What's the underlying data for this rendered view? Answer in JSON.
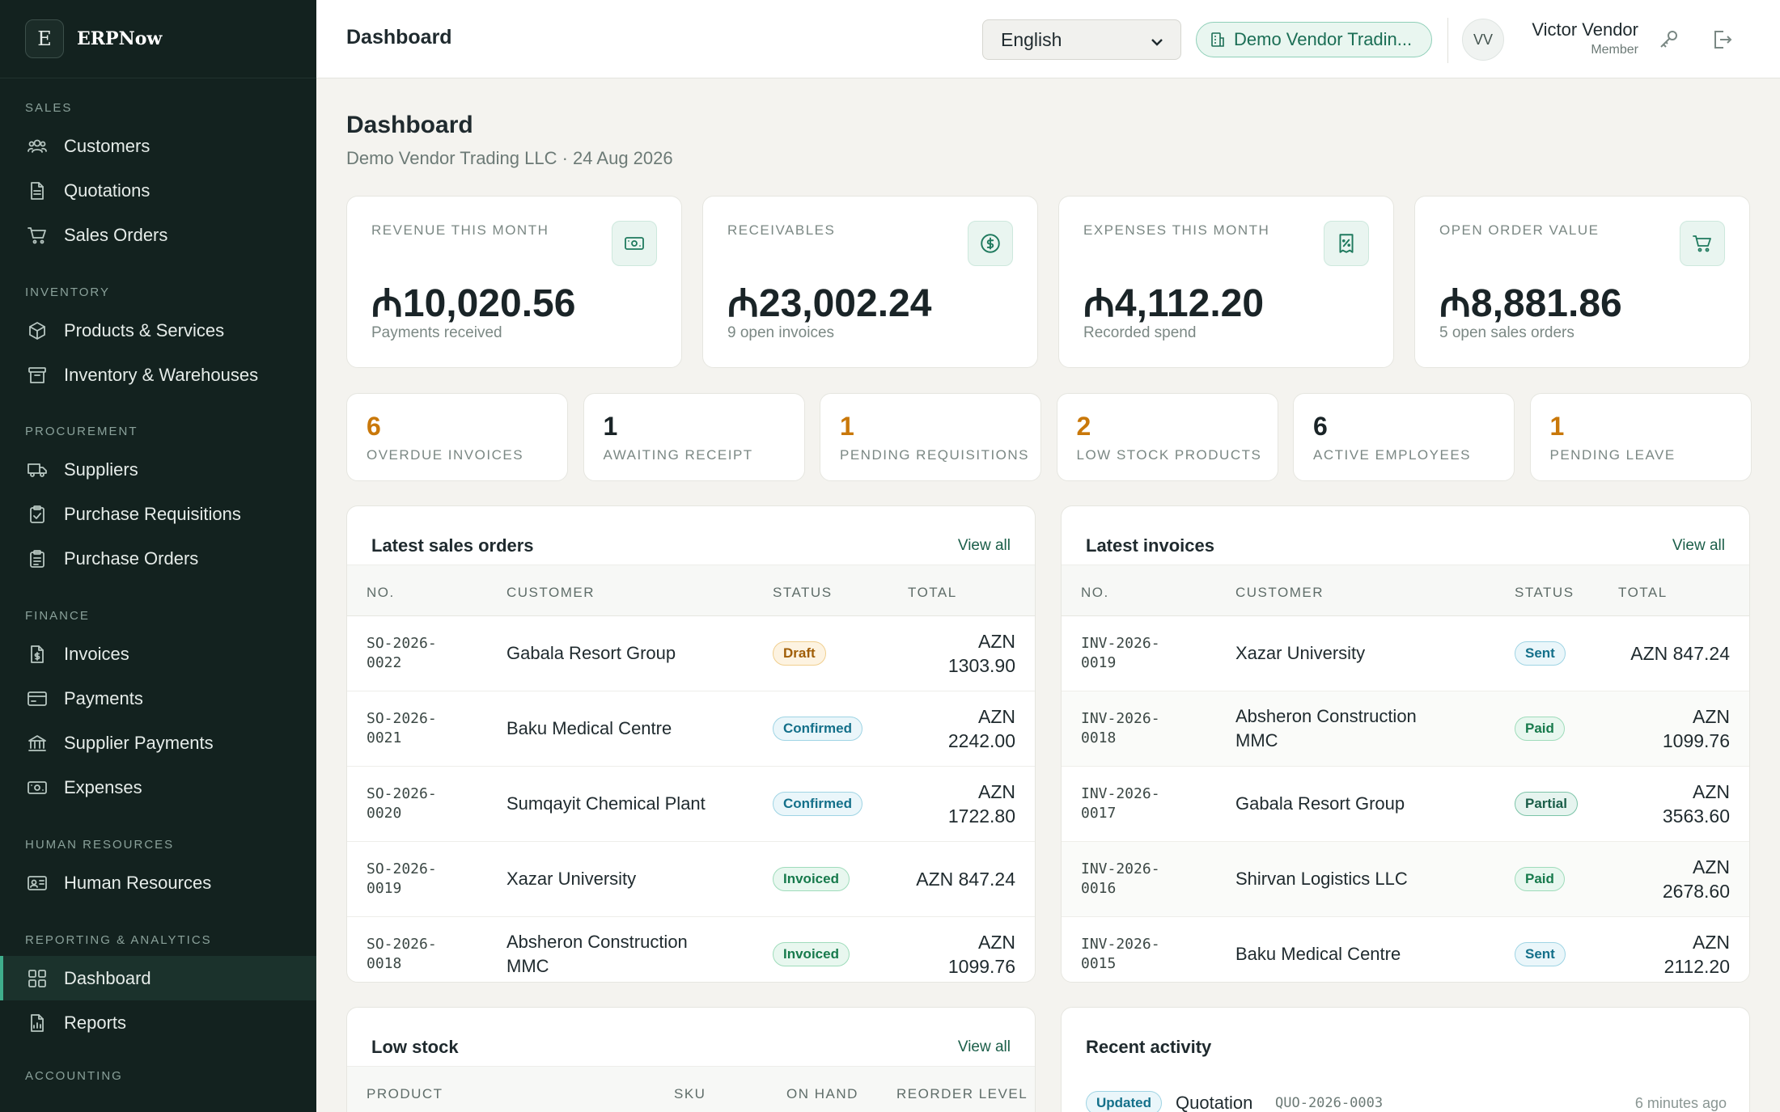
{
  "brand": {
    "letter": "E",
    "name": "ERPNow"
  },
  "sidebar": {
    "sections": [
      {
        "title": "SALES",
        "items": [
          {
            "label": "Customers",
            "icon": "users-icon"
          },
          {
            "label": "Quotations",
            "icon": "document-icon"
          },
          {
            "label": "Sales Orders",
            "icon": "cart-icon"
          }
        ]
      },
      {
        "title": "INVENTORY",
        "items": [
          {
            "label": "Products & Services",
            "icon": "box-icon"
          },
          {
            "label": "Inventory & Warehouses",
            "icon": "archive-icon"
          }
        ]
      },
      {
        "title": "PROCUREMENT",
        "items": [
          {
            "label": "Suppliers",
            "icon": "truck-icon"
          },
          {
            "label": "Purchase Requisitions",
            "icon": "clipboard-icon"
          },
          {
            "label": "Purchase Orders",
            "icon": "clipboard-list-icon"
          }
        ]
      },
      {
        "title": "FINANCE",
        "items": [
          {
            "label": "Invoices",
            "icon": "invoice-icon"
          },
          {
            "label": "Payments",
            "icon": "credit-card-icon"
          },
          {
            "label": "Supplier Payments",
            "icon": "bank-icon"
          },
          {
            "label": "Expenses",
            "icon": "banknote-icon"
          }
        ]
      },
      {
        "title": "HUMAN RESOURCES",
        "items": [
          {
            "label": "Human Resources",
            "icon": "id-card-icon"
          }
        ]
      },
      {
        "title": "REPORTING & ANALYTICS",
        "items": [
          {
            "label": "Dashboard",
            "icon": "grid-icon",
            "active": true
          },
          {
            "label": "Reports",
            "icon": "report-icon"
          }
        ]
      },
      {
        "title": "ACCOUNTING",
        "items": []
      }
    ]
  },
  "topbar": {
    "title": "Dashboard",
    "language": "English",
    "company": "Demo Vendor Tradin...",
    "avatar_initials": "VV",
    "user_name": "Victor Vendor",
    "user_role": "Member"
  },
  "page": {
    "title": "Dashboard",
    "subtitle": "Demo Vendor Trading LLC · 24 Aug 2026"
  },
  "kpis": [
    {
      "label": "REVENUE THIS MONTH",
      "value": "₼10,020.56",
      "note": "Payments received",
      "icon": "banknote-icon"
    },
    {
      "label": "RECEIVABLES",
      "value": "₼23,002.24",
      "note": "9 open invoices",
      "icon": "dollar-circle-icon"
    },
    {
      "label": "EXPENSES THIS MONTH",
      "value": "₼4,112.20",
      "note": "Recorded spend",
      "icon": "receipt-percent-icon"
    },
    {
      "label": "OPEN ORDER VALUE",
      "value": "₼8,881.86",
      "note": "5 open sales orders",
      "icon": "cart-icon"
    }
  ],
  "stats": [
    {
      "value": "6",
      "label": "OVERDUE INVOICES",
      "color": "#c9780a"
    },
    {
      "value": "1",
      "label": "AWAITING RECEIPT",
      "color": "#1a2427"
    },
    {
      "value": "1",
      "label": "PENDING REQUISITIONS",
      "color": "#c9780a"
    },
    {
      "value": "2",
      "label": "LOW STOCK PRODUCTS",
      "color": "#c9780a"
    },
    {
      "value": "6",
      "label": "ACTIVE EMPLOYEES",
      "color": "#1a2427"
    },
    {
      "value": "1",
      "label": "PENDING LEAVE",
      "color": "#c9780a"
    }
  ],
  "sales_orders": {
    "title": "Latest sales orders",
    "link": "View all",
    "headers": [
      "NO.",
      "CUSTOMER",
      "STATUS",
      "TOTAL"
    ],
    "rows": [
      {
        "no": [
          "SO-2026-",
          "0022"
        ],
        "customer": [
          "Gabala Resort Group"
        ],
        "status": "Draft",
        "status_kind": "draft",
        "total": [
          "AZN",
          "1303.90"
        ]
      },
      {
        "no": [
          "SO-2026-",
          "0021"
        ],
        "customer": [
          "Baku Medical Centre"
        ],
        "status": "Confirmed",
        "status_kind": "confirmed",
        "total": [
          "AZN",
          "2242.00"
        ]
      },
      {
        "no": [
          "SO-2026-",
          "0020"
        ],
        "customer": [
          "Sumqayit Chemical Plant"
        ],
        "status": "Confirmed",
        "status_kind": "confirmed",
        "total": [
          "AZN",
          "1722.80"
        ]
      },
      {
        "no": [
          "SO-2026-",
          "0019"
        ],
        "customer": [
          "Xazar University"
        ],
        "status": "Invoiced",
        "status_kind": "invoiced",
        "total": [
          "AZN 847.24"
        ]
      },
      {
        "no": [
          "SO-2026-",
          "0018"
        ],
        "customer": [
          "Absheron Construction",
          "MMC"
        ],
        "status": "Invoiced",
        "status_kind": "invoiced",
        "total": [
          "AZN",
          "1099.76"
        ]
      }
    ]
  },
  "invoices": {
    "title": "Latest invoices",
    "link": "View all",
    "headers": [
      "NO.",
      "CUSTOMER",
      "STATUS",
      "TOTAL"
    ],
    "rows": [
      {
        "no": [
          "INV-2026-",
          "0019"
        ],
        "customer": [
          "Xazar University"
        ],
        "status": "Sent",
        "status_kind": "sent",
        "total": [
          "AZN 847.24"
        ]
      },
      {
        "no": [
          "INV-2026-",
          "0018"
        ],
        "customer": [
          "Absheron Construction",
          "MMC"
        ],
        "status": "Paid",
        "status_kind": "paid",
        "total": [
          "AZN",
          "1099.76"
        ]
      },
      {
        "no": [
          "INV-2026-",
          "0017"
        ],
        "customer": [
          "Gabala Resort Group"
        ],
        "status": "Partial",
        "status_kind": "partial",
        "total": [
          "AZN",
          "3563.60"
        ]
      },
      {
        "no": [
          "INV-2026-",
          "0016"
        ],
        "customer": [
          "Shirvan Logistics LLC"
        ],
        "status": "Paid",
        "status_kind": "paid",
        "total": [
          "AZN",
          "2678.60"
        ]
      },
      {
        "no": [
          "INV-2026-",
          "0015"
        ],
        "customer": [
          "Baku Medical Centre"
        ],
        "status": "Sent",
        "status_kind": "sent",
        "total": [
          "AZN",
          "2112.20"
        ]
      }
    ]
  },
  "low_stock": {
    "title": "Low stock",
    "link": "View all",
    "headers": [
      "PRODUCT",
      "SKU",
      "ON HAND",
      "REORDER LEVEL"
    ]
  },
  "activity": {
    "title": "Recent activity",
    "items": [
      {
        "badge": "Updated",
        "entity": "Quotation",
        "ref": "QUO-2026-0003",
        "time": "6 minutes ago"
      }
    ]
  }
}
